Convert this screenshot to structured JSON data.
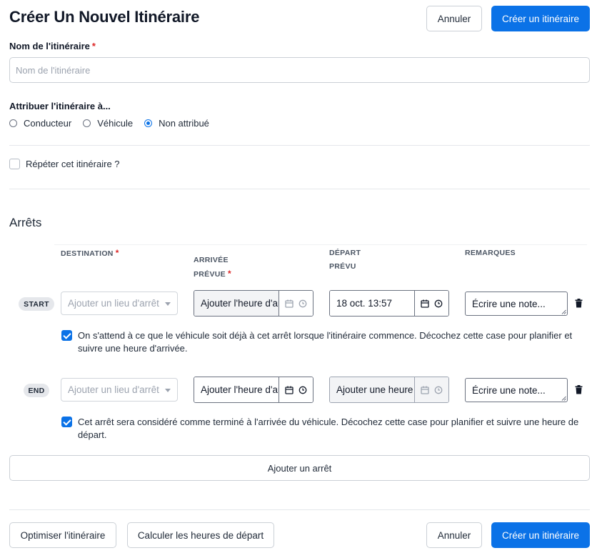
{
  "header": {
    "title": "Créer Un Nouvel Itinéraire",
    "cancel_label": "Annuler",
    "create_label": "Créer un itinéraire"
  },
  "form": {
    "name_label": "Nom de l'itinéraire",
    "required_mark": "*",
    "name_placeholder": "Nom de l'itinéraire",
    "assign_label": "Attribuer l'itinéraire à...",
    "assign_options": [
      {
        "label": "Conducteur",
        "selected": false
      },
      {
        "label": "Véhicule",
        "selected": false
      },
      {
        "label": "Non attribué",
        "selected": true
      }
    ],
    "repeat_label": "Répéter cet itinéraire ?",
    "repeat_checked": false
  },
  "stops": {
    "section_title": "Arrêts",
    "columns": {
      "destination": "DESTINATION",
      "arrival_line1": "ARRIVÉE",
      "arrival_line2": "PRÉVUE",
      "departure_line1": "DÉPART",
      "departure_line2": "PRÉVU",
      "remarks": "REMARQUES"
    },
    "rows": [
      {
        "badge": "START",
        "destination_placeholder": "Ajouter un lieu d'arrêt",
        "arrival_value": "Ajouter l'heure d'arrivée",
        "arrival_disabled": false,
        "departure_value": "18 oct. 13:57",
        "departure_disabled": false,
        "note_value": "Écrire une note...",
        "checkbox_checked": true,
        "checkbox_text": "On s'attend à ce que le véhicule soit déjà à cet arrêt lorsque l'itinéraire commence. Décochez cette case pour planifier et suivre une heure d'arrivée."
      },
      {
        "badge": "END",
        "destination_placeholder": "Ajouter un lieu d'arrêt",
        "arrival_value": "Ajouter l'heure d'arrivée",
        "arrival_disabled": false,
        "departure_value": "Ajouter une heure de départ",
        "departure_disabled": true,
        "note_value": "Écrire une note...",
        "checkbox_checked": true,
        "checkbox_text": "Cet arrêt sera considéré comme terminé à l'arrivée du véhicule. Décochez cette case pour planifier et suivre une heure de départ."
      }
    ],
    "add_stop_label": "Ajouter un arrêt"
  },
  "footer": {
    "optimize_label": "Optimiser l'itinéraire",
    "calculate_label": "Calculer les heures de départ",
    "cancel_label": "Annuler",
    "create_label": "Créer un itinéraire"
  },
  "colors": {
    "primary": "#0b72e7",
    "required": "#dc2626",
    "badge_bg": "#e5e7eb"
  }
}
